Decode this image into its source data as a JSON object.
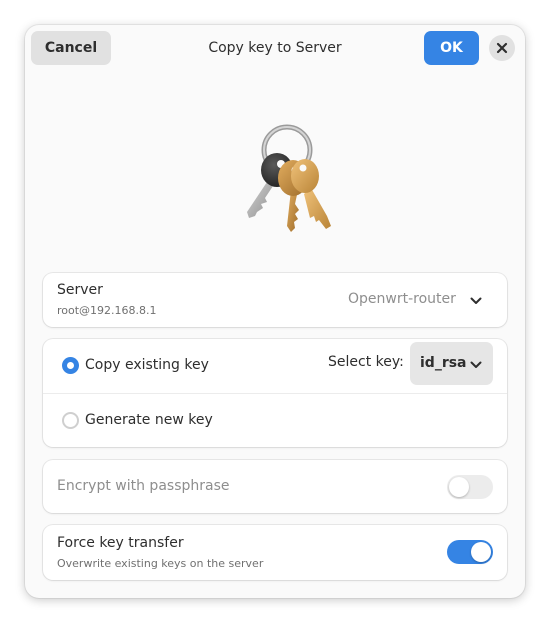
{
  "header": {
    "cancel_label": "Cancel",
    "title": "Copy key to Server",
    "ok_label": "OK",
    "close_icon": "close-icon"
  },
  "hero_icon": "keys-icon",
  "server": {
    "label": "Server",
    "address": "root@192.168.8.1",
    "selected": "Openwrt-router",
    "icon": "chevron-down-icon"
  },
  "key_mode": {
    "copy_existing": {
      "label": "Copy existing key",
      "checked": true
    },
    "select_key_label": "Select key:",
    "selected_key": "id_rsa",
    "generate_new": {
      "label": "Generate new key",
      "checked": false
    }
  },
  "encrypt": {
    "label": "Encrypt with passphrase",
    "enabled": false,
    "on": false
  },
  "force_transfer": {
    "label": "Force key transfer",
    "subtitle": "Overwrite existing keys on the server",
    "on": true
  },
  "colors": {
    "accent": "#3584e4",
    "button_bg": "#e1e1e1",
    "card_bg": "#ffffff",
    "dialog_bg": "#fafafa"
  }
}
